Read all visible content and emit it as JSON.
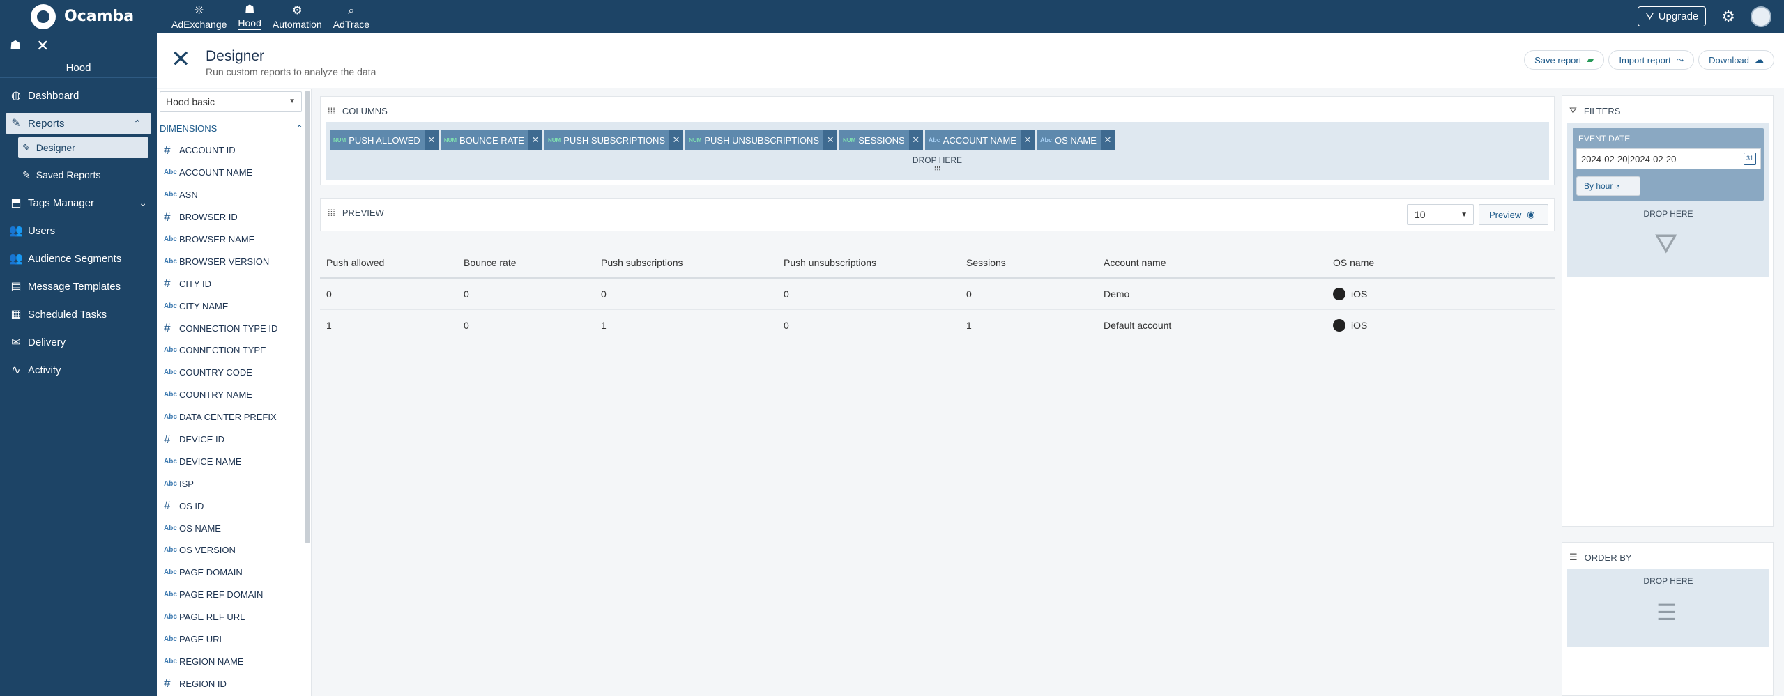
{
  "app": {
    "brand": "Ocamba"
  },
  "topnav": [
    {
      "label": "AdExchange",
      "icon": "❊"
    },
    {
      "label": "Hood",
      "icon": "☗",
      "active": true
    },
    {
      "label": "Automation",
      "icon": "⚙"
    },
    {
      "label": "AdTrace",
      "icon": "⌕"
    }
  ],
  "topbar": {
    "upgrade_label": "Upgrade"
  },
  "sidebar": {
    "title": "Hood",
    "items": [
      {
        "label": "Dashboard",
        "icon": "◍"
      },
      {
        "label": "Reports",
        "icon": "✎"
      },
      {
        "label": "Designer",
        "icon": "✎"
      },
      {
        "label": "Saved Reports",
        "icon": "✎"
      },
      {
        "label": "Tags Manager",
        "icon": "⬒"
      },
      {
        "label": "Users",
        "icon": "👥"
      },
      {
        "label": "Audience Segments",
        "icon": "👥"
      },
      {
        "label": "Message Templates",
        "icon": "▤"
      },
      {
        "label": "Scheduled Tasks",
        "icon": "▦"
      },
      {
        "label": "Delivery",
        "icon": "✉"
      },
      {
        "label": "Activity",
        "icon": "∿"
      }
    ]
  },
  "page": {
    "title": "Designer",
    "subtitle": "Run custom reports to analyze the data",
    "actions": {
      "save": "Save report",
      "import": "Import report",
      "download": "Download"
    }
  },
  "dimensions": {
    "dropdown_value": "Hood basic",
    "header": "DIMENSIONS",
    "items": [
      {
        "type": "#",
        "label": "ACCOUNT ID"
      },
      {
        "type": "Abc",
        "label": "ACCOUNT NAME"
      },
      {
        "type": "Abc",
        "label": "ASN"
      },
      {
        "type": "#",
        "label": "BROWSER ID"
      },
      {
        "type": "Abc",
        "label": "BROWSER NAME"
      },
      {
        "type": "Abc",
        "label": "BROWSER VERSION"
      },
      {
        "type": "#",
        "label": "CITY ID"
      },
      {
        "type": "Abc",
        "label": "CITY NAME"
      },
      {
        "type": "#",
        "label": "CONNECTION TYPE ID"
      },
      {
        "type": "Abc",
        "label": "CONNECTION TYPE"
      },
      {
        "type": "Abc",
        "label": "COUNTRY CODE"
      },
      {
        "type": "Abc",
        "label": "COUNTRY NAME"
      },
      {
        "type": "Abc",
        "label": "DATA CENTER PREFIX"
      },
      {
        "type": "#",
        "label": "DEVICE ID"
      },
      {
        "type": "Abc",
        "label": "DEVICE NAME"
      },
      {
        "type": "Abc",
        "label": "ISP"
      },
      {
        "type": "#",
        "label": "OS ID"
      },
      {
        "type": "Abc",
        "label": "OS NAME"
      },
      {
        "type": "Abc",
        "label": "OS VERSION"
      },
      {
        "type": "Abc",
        "label": "PAGE DOMAIN"
      },
      {
        "type": "Abc",
        "label": "PAGE REF DOMAIN"
      },
      {
        "type": "Abc",
        "label": "PAGE REF URL"
      },
      {
        "type": "Abc",
        "label": "PAGE URL"
      },
      {
        "type": "Abc",
        "label": "REGION NAME"
      },
      {
        "type": "#",
        "label": "REGION ID"
      }
    ]
  },
  "columns": {
    "header": "COLUMNS",
    "drop_label": "DROP HERE",
    "chips": [
      {
        "type": "NUM",
        "label": "PUSH ALLOWED"
      },
      {
        "type": "NUM",
        "label": "BOUNCE RATE"
      },
      {
        "type": "NUM",
        "label": "PUSH SUBSCRIPTIONS"
      },
      {
        "type": "NUM",
        "label": "PUSH UNSUBSCRIPTIONS"
      },
      {
        "type": "NUM",
        "label": "SESSIONS"
      },
      {
        "type": "Abc",
        "label": "ACCOUNT NAME"
      },
      {
        "type": "Abc",
        "label": "OS NAME"
      }
    ]
  },
  "preview": {
    "header": "PREVIEW",
    "page_size": "10",
    "button_label": "Preview"
  },
  "table": {
    "headers": [
      "Push allowed",
      "Bounce rate",
      "Push subscriptions",
      "Push unsubscriptions",
      "Sessions",
      "Account name",
      "OS name"
    ],
    "rows": [
      [
        "0",
        "0",
        "0",
        "0",
        "0",
        "Demo",
        "iOS"
      ],
      [
        "1",
        "0",
        "1",
        "0",
        "1",
        "Default account",
        "iOS"
      ]
    ]
  },
  "filters": {
    "header": "FILTERS",
    "event_label": "EVENT DATE",
    "date_value": "2024-02-20|2024-02-20",
    "byhour_label": "By hour",
    "drop_label": "DROP HERE"
  },
  "orderby": {
    "header": "ORDER BY",
    "drop_label": "DROP HERE"
  }
}
